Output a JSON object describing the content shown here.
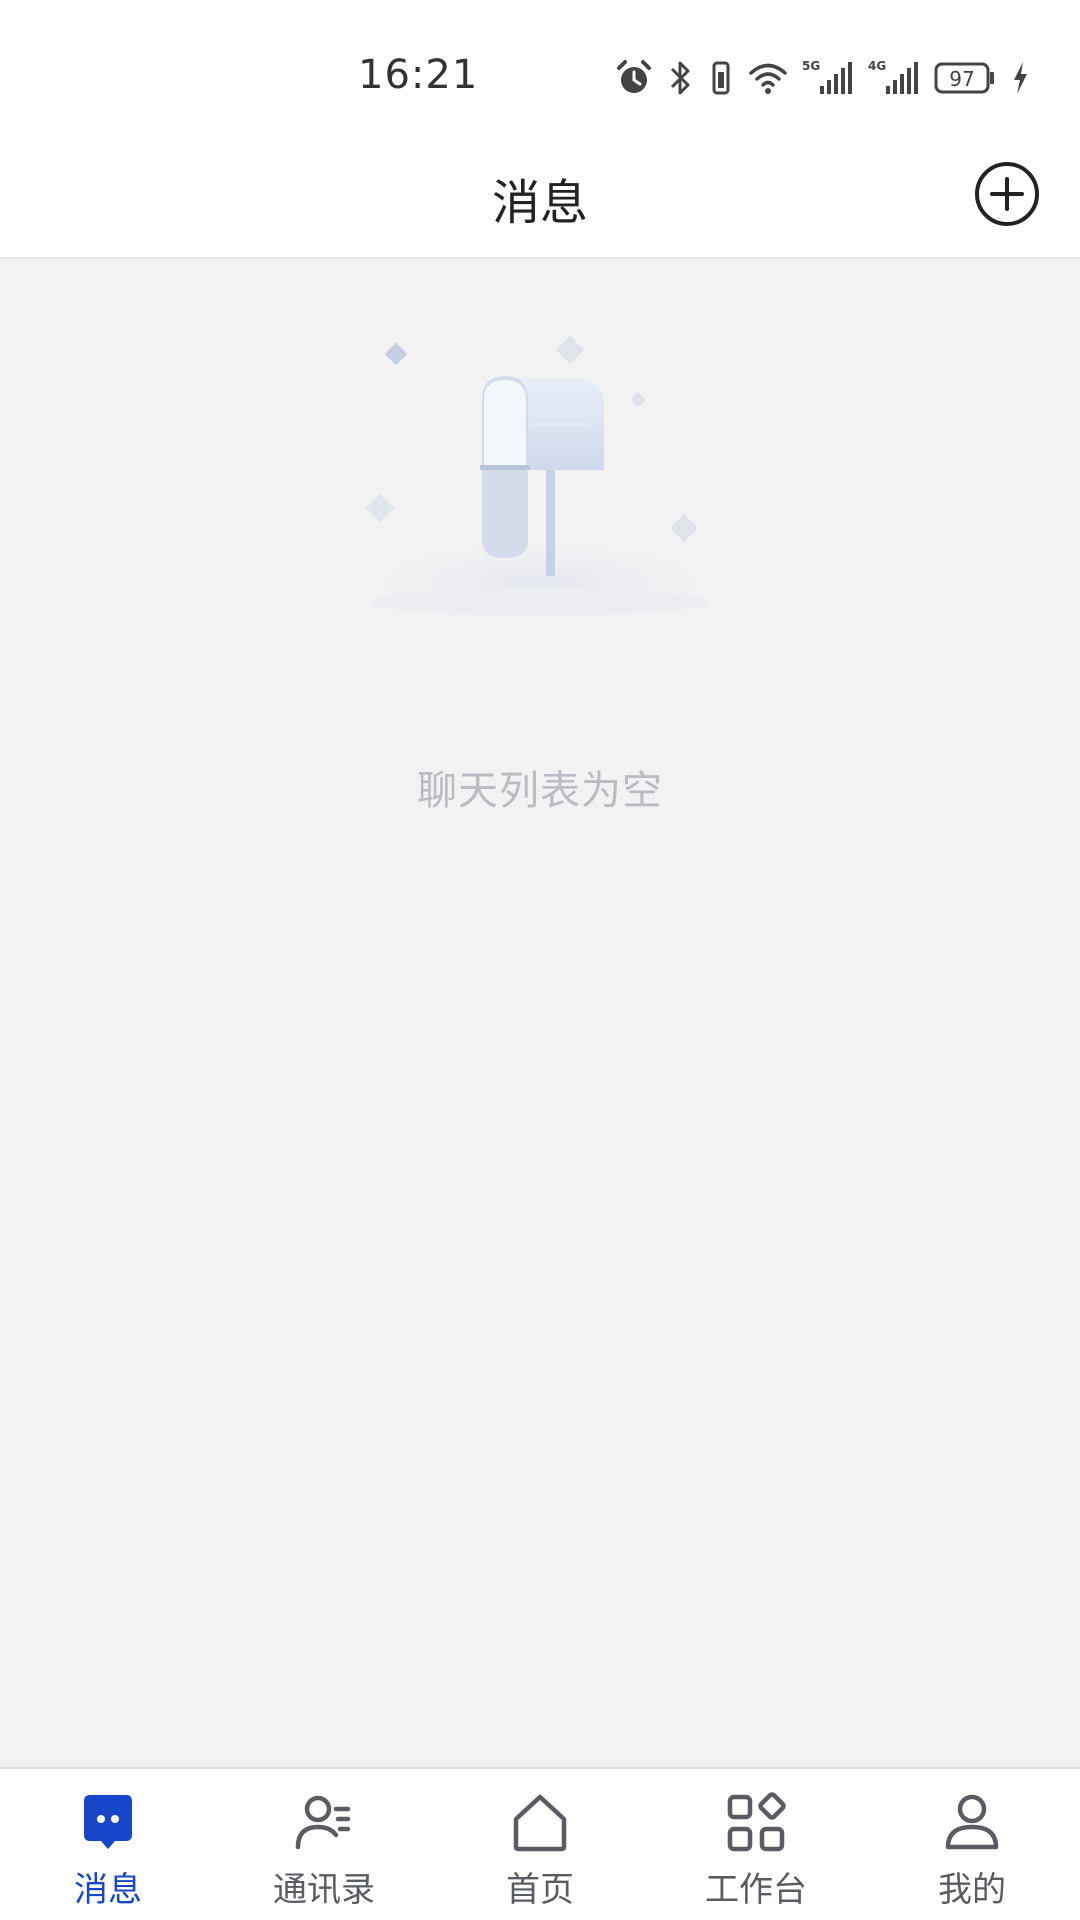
{
  "status_bar": {
    "time": "16:21",
    "battery": "97",
    "network_5g": "5G",
    "network_4g": "4G",
    "icons": [
      "alarm-icon",
      "bluetooth-icon",
      "vibrate-icon",
      "wifi-icon",
      "signal-5g-icon",
      "signal-4g-icon",
      "battery-icon",
      "charging-icon"
    ]
  },
  "header": {
    "title": "消息",
    "add_icon": "plus-circle-icon"
  },
  "empty_state": {
    "illustration": "mailbox-illustration",
    "text": "聊天列表为空"
  },
  "bottom_nav": {
    "active_color": "#1846c9",
    "inactive_color": "#5a5c63",
    "items": [
      {
        "label": "消息",
        "icon": "chat-bubble-icon",
        "active": true
      },
      {
        "label": "通讯录",
        "icon": "contacts-icon",
        "active": false
      },
      {
        "label": "首页",
        "icon": "home-icon",
        "active": false
      },
      {
        "label": "工作台",
        "icon": "apps-grid-icon",
        "active": false
      },
      {
        "label": "我的",
        "icon": "user-icon",
        "active": false
      }
    ]
  }
}
